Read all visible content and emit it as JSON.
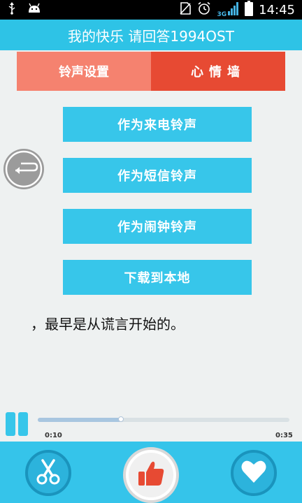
{
  "status_bar": {
    "network_label": "3G",
    "time": "14:45",
    "icons": [
      "usb-icon",
      "android-icon",
      "no-sim-icon",
      "alarm-icon",
      "signal-icon",
      "battery-icon"
    ]
  },
  "header": {
    "title": "我的快乐 请回答1994OST"
  },
  "tabs": [
    {
      "label": "铃声设置",
      "color": "#f5826f"
    },
    {
      "label": "心情墙",
      "color": "#e74a33"
    }
  ],
  "actions": [
    {
      "label": "作为来电铃声"
    },
    {
      "label": "作为短信铃声"
    },
    {
      "label": "作为闹钟铃声"
    },
    {
      "label": "下载到本地"
    }
  ],
  "lyric": "，最早是从谎言开始的。",
  "player": {
    "current_time": "0:10",
    "total_time": "0:35",
    "progress": 0.33
  },
  "bottom_bar": {
    "icons": [
      "scissors-icon",
      "thumbs-up-icon",
      "heart-icon"
    ]
  },
  "colors": {
    "accent": "#37c6ea",
    "title_bar": "#2ec3e6",
    "like_red": "#e74a33"
  }
}
